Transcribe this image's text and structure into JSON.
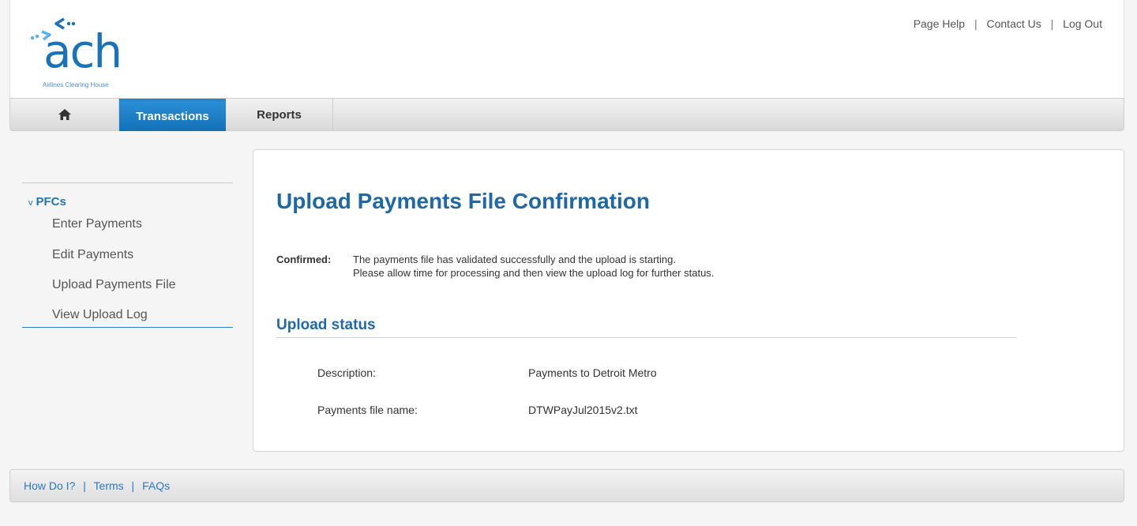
{
  "brand": {
    "logo_text": "ach",
    "logo_tagline": "Airlines Clearing House",
    "primary_color": "#1a72b8"
  },
  "top_links": {
    "page_help": "Page Help",
    "contact_us": "Contact Us",
    "log_out": "Log Out",
    "separator": "|"
  },
  "nav": {
    "home_icon": "home-icon",
    "items": [
      {
        "label": "Transactions",
        "active": true
      },
      {
        "label": "Reports",
        "active": false
      }
    ]
  },
  "sidebar": {
    "section_caret": "v",
    "section_label": "PFCs",
    "items": [
      {
        "label": "Enter Payments"
      },
      {
        "label": "Edit Payments"
      },
      {
        "label": "Upload Payments File"
      },
      {
        "label": "View Upload Log"
      }
    ]
  },
  "main": {
    "title": "Upload Payments File Confirmation",
    "confirm_label": "Confirmed:",
    "confirm_line1": "The payments file has validated successfully and the upload is starting.",
    "confirm_line2": "Please allow time for processing and then view the upload log for further status.",
    "section_title": "Upload status",
    "rows": [
      {
        "label": "Description:",
        "value": "Payments to Detroit Metro"
      },
      {
        "label": "Payments file name:",
        "value": "DTWPayJul2015v2.txt"
      }
    ]
  },
  "footer": {
    "links": [
      {
        "label": "How Do I?"
      },
      {
        "label": "Terms"
      },
      {
        "label": "FAQs"
      }
    ],
    "separator": "|"
  }
}
